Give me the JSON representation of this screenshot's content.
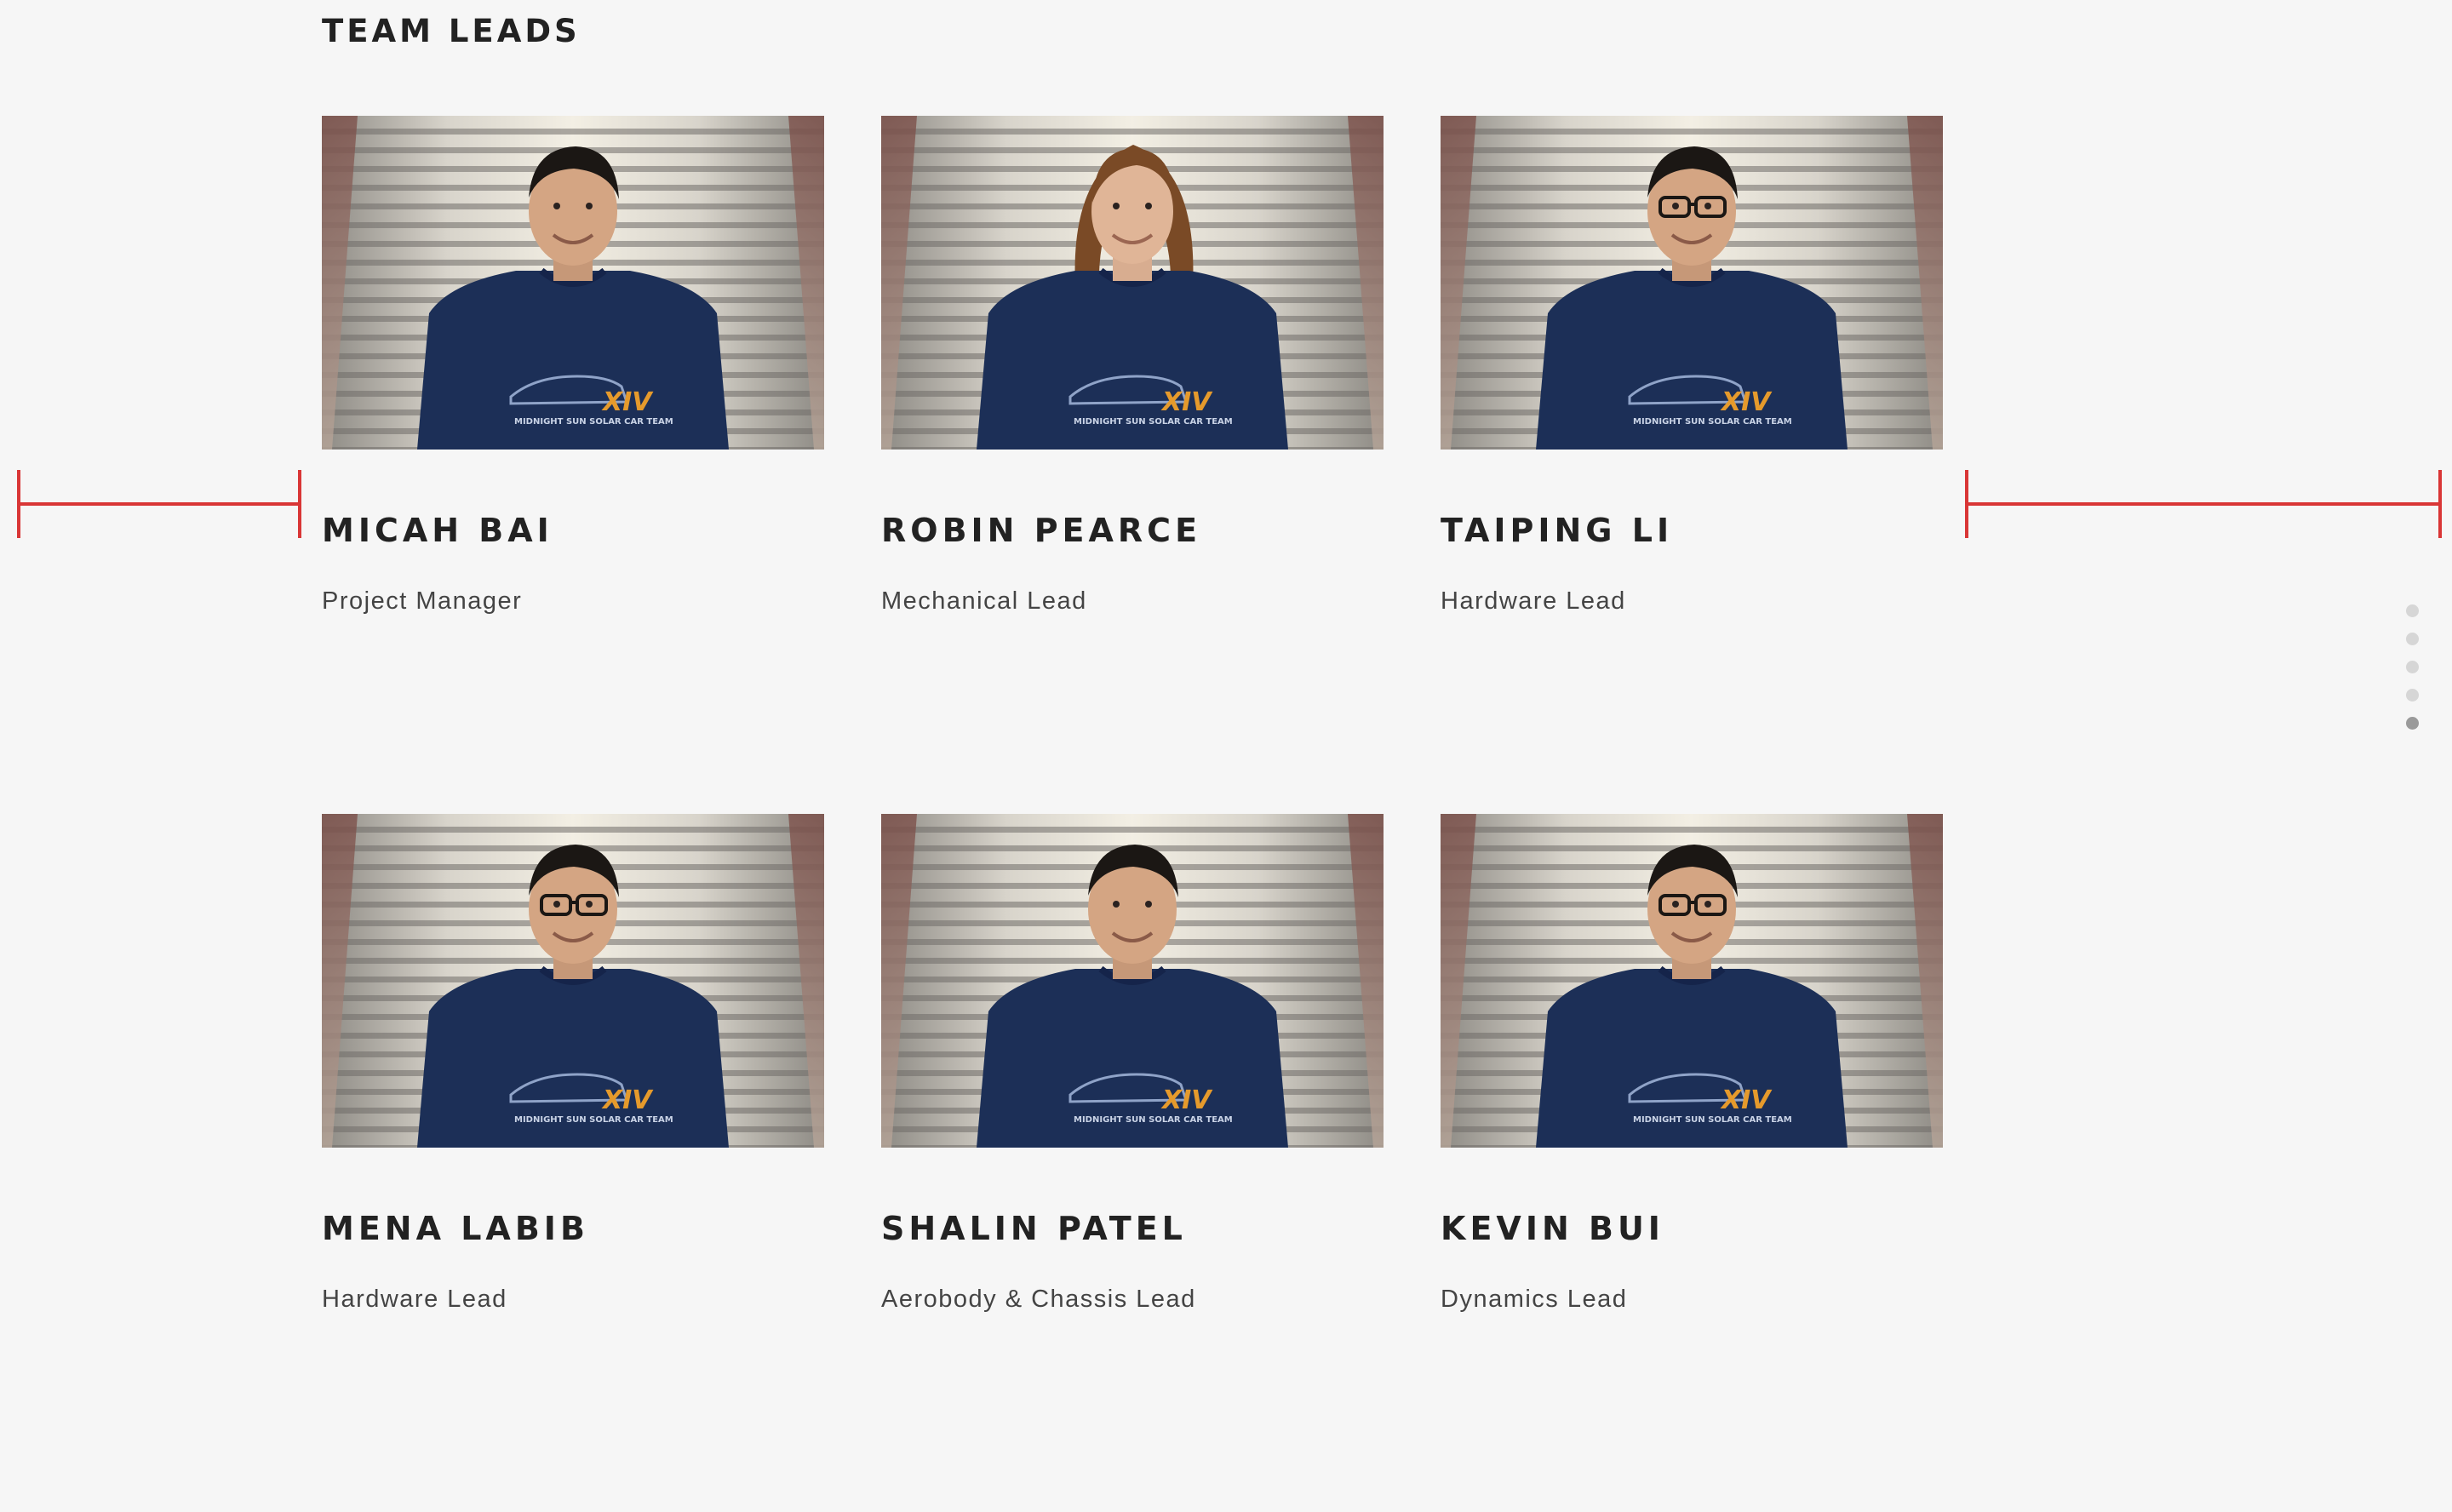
{
  "section": {
    "title": "TEAM LEADS"
  },
  "members": [
    {
      "name": "MICAH BAI",
      "role": "Project Manager"
    },
    {
      "name": "ROBIN PEARCE",
      "role": "Mechanical Lead"
    },
    {
      "name": "TAIPING LI",
      "role": "Hardware Lead"
    },
    {
      "name": "MENA LABIB",
      "role": "Hardware Lead"
    },
    {
      "name": "SHALIN PATEL",
      "role": "Aerobody & Chassis Lead"
    },
    {
      "name": "KEVIN BUI",
      "role": "Dynamics Lead"
    }
  ],
  "pagination": {
    "dot_count": 5,
    "active_index": 4
  },
  "colors": {
    "background": "#f6f6f6",
    "guide_line": "#d93636",
    "shirt": "#1c2f57",
    "shirt_logo": "#e59a2c"
  }
}
